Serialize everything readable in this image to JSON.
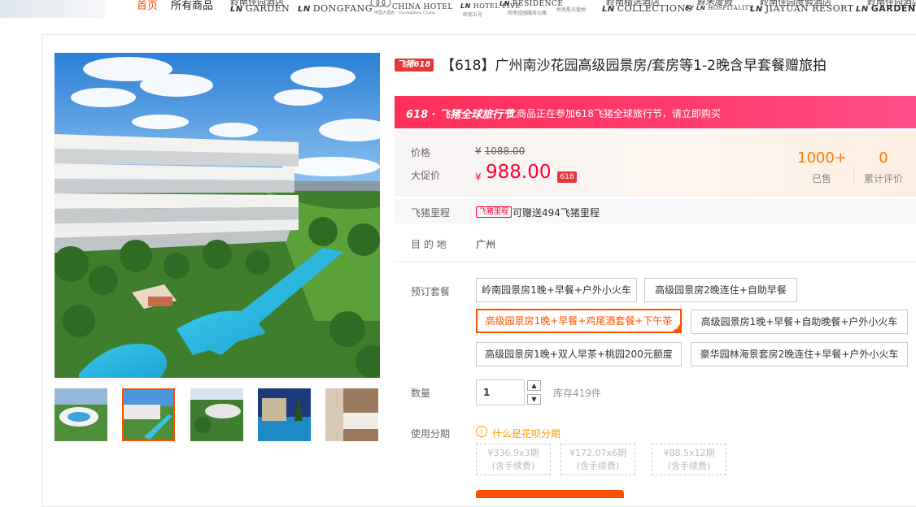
{
  "nav": {
    "home": "首页",
    "all_products": "所有商品",
    "brands": [
      {
        "top": "岭南佳园酒店",
        "main": "GARDEN",
        "mark": "LN"
      },
      {
        "top": "",
        "main": "DONGFANG",
        "mark": "LN"
      },
      {
        "top": "",
        "main": "CHINA HOTEL",
        "mark": "",
        "sub": "中国大酒店 · Guangzhou China"
      },
      {
        "top": "",
        "main": "HOTEL FIVE",
        "mark": "LN",
        "sub": "岭南五号"
      },
      {
        "top": "",
        "main": "RESIDENCE",
        "mark": "LN",
        "sub": "岭南佳园服务公寓"
      },
      {
        "top": "",
        "main": "",
        "mark": "",
        "sub": "岭南星光营地"
      },
      {
        "top": "岭南精选酒店",
        "main": "COLLECTIONS",
        "mark": "LN"
      },
      {
        "top": "鲜禾度假",
        "main": "HOSPITALITY",
        "mark": "BY LN"
      },
      {
        "top": "岭南佳园度假酒店",
        "main": "JIAYUAN RESORT",
        "mark": "LN"
      },
      {
        "top": "岭南佳园酒店",
        "main": "GARDEN H",
        "mark": "LN"
      }
    ]
  },
  "product": {
    "badge": "飞猪618",
    "title": "【618】广州南沙花园高级园景房/套房等1-2晚含早套餐赠旅拍"
  },
  "festival": {
    "name": "618 · 飞猪全球旅行节",
    "desc": "此商品正在参加618飞猪全球旅行节，请立即购买"
  },
  "price": {
    "label": "价格",
    "currency": "¥",
    "original": "1088.00",
    "promo_label": "大促价",
    "promo": "988.00",
    "promo_tag": "618"
  },
  "stats": {
    "sold_num": "1000+",
    "sold_label": "已售",
    "review_num": "0",
    "review_label": "累计评价"
  },
  "miles": {
    "label": "飞猪里程",
    "tag": "飞猪里程",
    "text": "可赠送494飞猪里程"
  },
  "destination": {
    "label": "目 的 地",
    "value": "广州"
  },
  "packages": {
    "label": "预订套餐",
    "options": [
      "岭南园景房1晚+早餐+户外小火车",
      "高级园景房2晚连住+自助早餐",
      "高级园景房1晚+早餐+鸡尾酒套餐+下午茶",
      "高级园景房1晚+早餐+自助晚餐+户外小火车",
      "高级园景房1晚+双人早茶+桃园200元额度",
      "豪华园林海景套房2晚连住+早餐+户外小火车"
    ]
  },
  "quantity": {
    "label": "数量",
    "value": "1",
    "up": "▲",
    "down": "▼",
    "stock": "库存419件"
  },
  "installment": {
    "label": "使用分期",
    "info_icon": "i",
    "link": "什么是花呗分期",
    "options": [
      {
        "amount": "¥336.9x3期",
        "note": "(含手续费)"
      },
      {
        "amount": "¥172.07x6期",
        "note": "(含手续费)"
      },
      {
        "amount": "¥88.5x12期",
        "note": "(含手续费)"
      }
    ]
  }
}
